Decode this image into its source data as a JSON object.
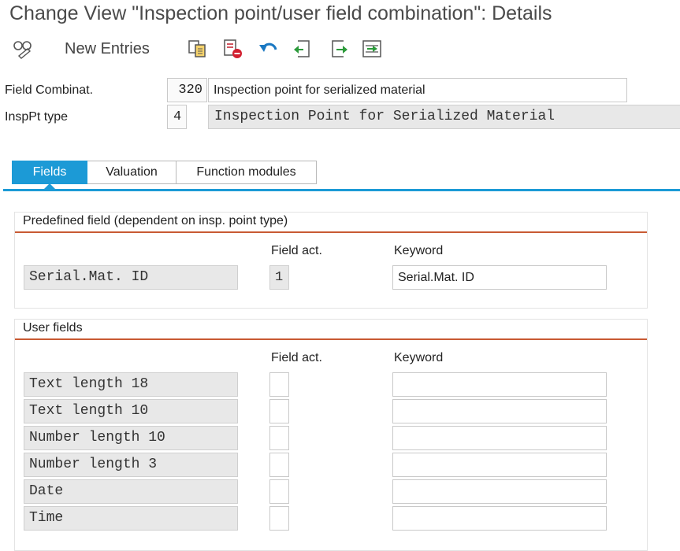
{
  "window": {
    "title": "Change View \"Inspection point/user field combination\": Details"
  },
  "toolbar": {
    "new_entries_label": "New Entries",
    "icons": [
      "display-change-icon",
      "copy-icon",
      "delete-icon",
      "undo-icon",
      "previous-entry-icon",
      "next-entry-icon",
      "select-all-icon"
    ]
  },
  "header": {
    "field_combination": {
      "label": "Field Combinat.",
      "value": "320",
      "description": "Inspection point for serialized material"
    },
    "insp_pt_type": {
      "label": "InspPt type",
      "value": "4",
      "description": "Inspection Point for Serialized Material"
    }
  },
  "tabs": [
    {
      "label": "Fields",
      "active": true
    },
    {
      "label": "Valuation",
      "active": false
    },
    {
      "label": "Function modules",
      "active": false
    }
  ],
  "predefined": {
    "title": "Predefined field (dependent on insp. point type)",
    "col_field_act": "Field act.",
    "col_keyword": "Keyword",
    "row": {
      "field": "Serial.Mat. ID",
      "field_act": "1",
      "keyword": "Serial.Mat. ID"
    }
  },
  "user_fields": {
    "title": "User fields",
    "col_field_act": "Field act.",
    "col_keyword": "Keyword",
    "rows": [
      {
        "field": "Text length 18",
        "field_act": "",
        "keyword": ""
      },
      {
        "field": "Text length 10",
        "field_act": "",
        "keyword": ""
      },
      {
        "field": "Number length 10",
        "field_act": "",
        "keyword": ""
      },
      {
        "field": "Number length 3",
        "field_act": "",
        "keyword": ""
      },
      {
        "field": "Date",
        "field_act": "",
        "keyword": ""
      },
      {
        "field": "Time",
        "field_act": "",
        "keyword": ""
      }
    ]
  },
  "colors": {
    "accent": "#1c9ad6",
    "group_rule": "#c85a33",
    "readonly_bg": "#e8e8e8"
  }
}
